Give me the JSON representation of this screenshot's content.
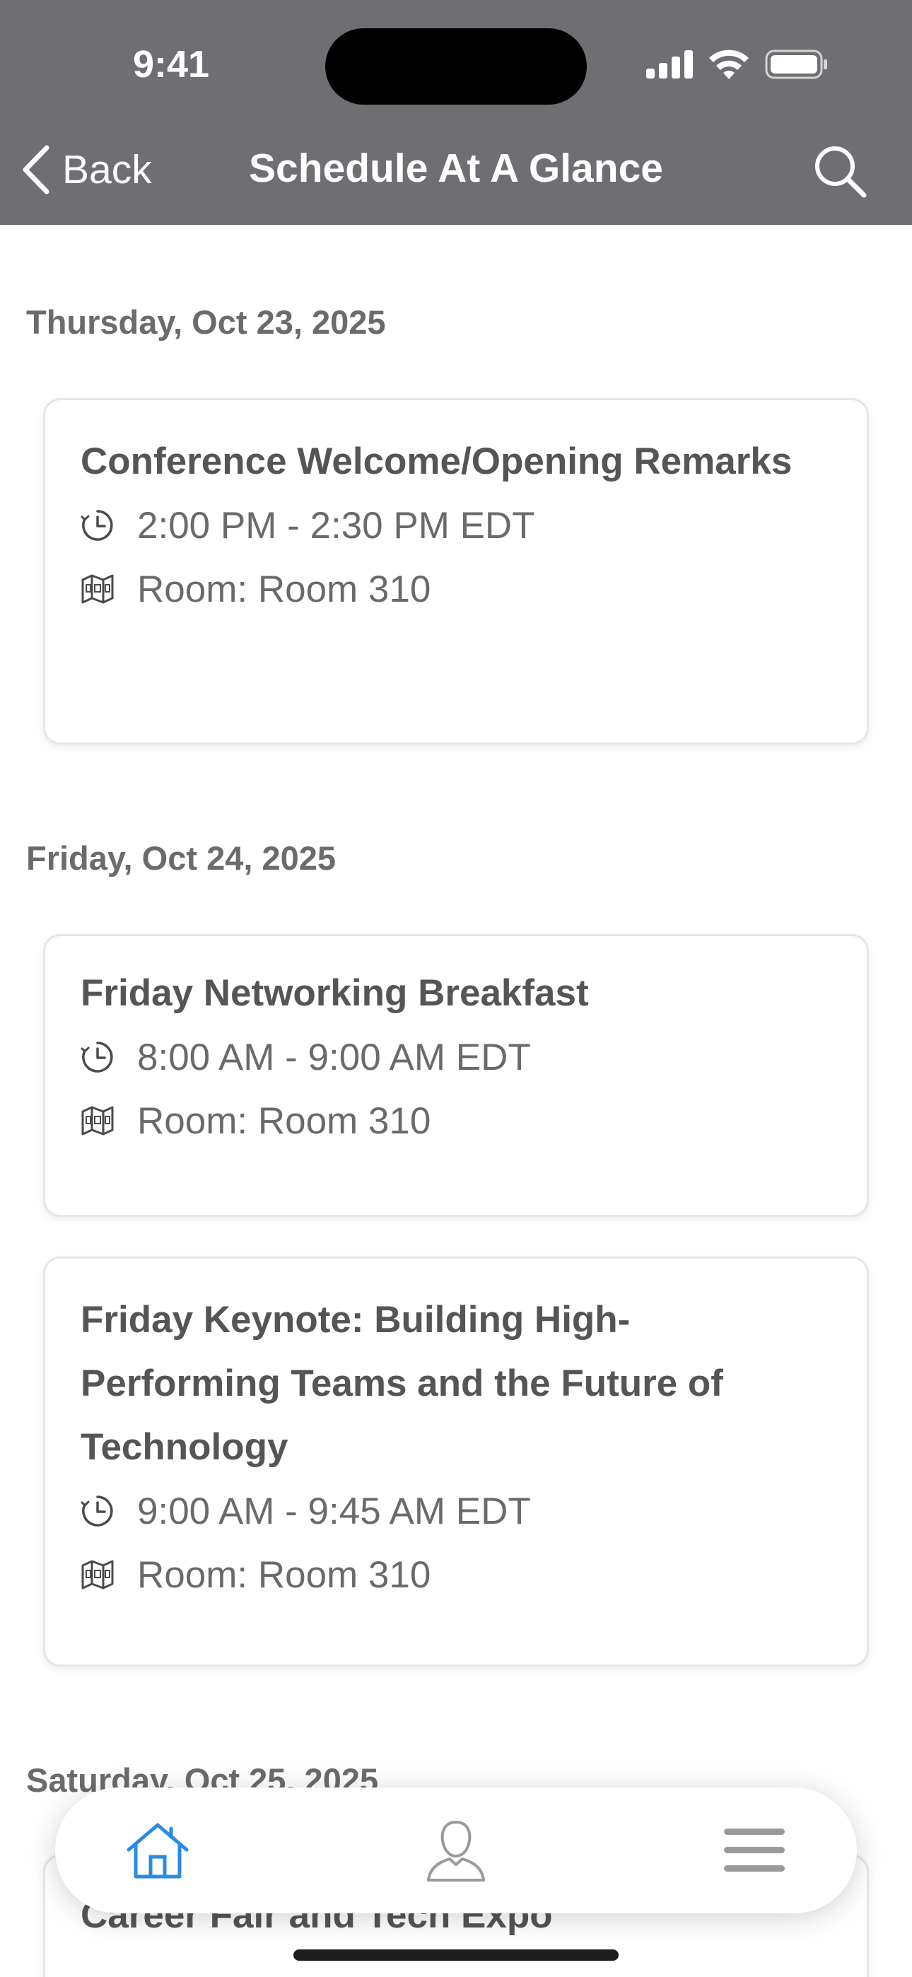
{
  "status_bar": {
    "time": "9:41"
  },
  "nav": {
    "back_label": "Back",
    "title": "Schedule At A Glance"
  },
  "days": [
    {
      "date": "Thursday, Oct 23, 2025",
      "sessions": [
        {
          "title": "Conference Welcome/Opening Remarks",
          "time": "2:00 PM - 2:30 PM EDT",
          "room": "Room: Room 310"
        }
      ]
    },
    {
      "date": "Friday, Oct 24, 2025",
      "sessions": [
        {
          "title": "Friday Networking Breakfast",
          "time": "8:00 AM - 9:00 AM EDT",
          "room": "Room: Room 310"
        },
        {
          "title": "Friday Keynote: Building High-Performing Teams and the Future of Technology",
          "time": "9:00 AM - 9:45 AM EDT",
          "room": "Room: Room 310"
        }
      ]
    },
    {
      "date": "Saturday, Oct 25, 2025",
      "sessions": [
        {
          "title": "Career Fair and Tech Expo"
        }
      ]
    }
  ],
  "tab_bar": {
    "icons": [
      "home-icon",
      "profile-icon",
      "menu-icon"
    ],
    "active_color": "#2a8be0",
    "inactive_color": "#9a9a9a"
  }
}
